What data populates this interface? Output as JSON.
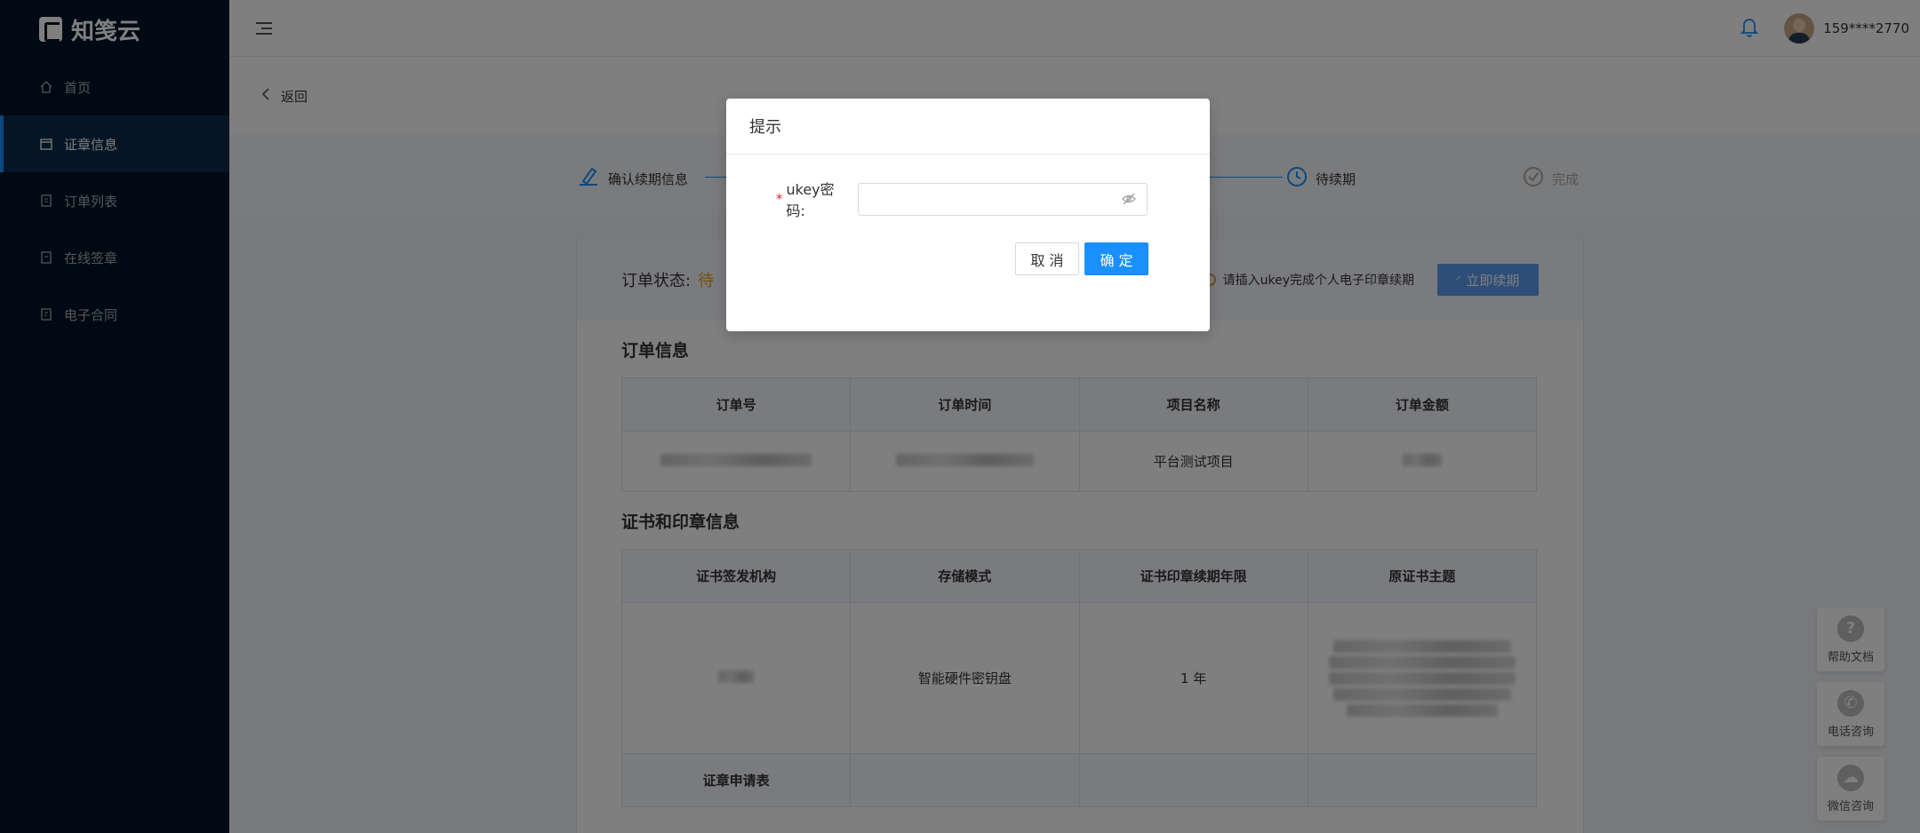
{
  "app": {
    "logo_text": "知笺云"
  },
  "sidebar": {
    "items": [
      {
        "label": "首页",
        "icon": "home-icon",
        "active": false
      },
      {
        "label": "证章信息",
        "icon": "stamp-icon",
        "active": true
      },
      {
        "label": "订单列表",
        "icon": "order-list-icon",
        "active": false
      },
      {
        "label": "在线签章",
        "icon": "sign-icon",
        "active": false
      },
      {
        "label": "电子合同",
        "icon": "contract-icon",
        "active": false
      }
    ]
  },
  "header": {
    "username": "159****2770"
  },
  "page": {
    "back_label": "返回"
  },
  "steps": [
    {
      "label": "确认续期信息"
    },
    {
      "label": "待续期"
    },
    {
      "label": "完成"
    }
  ],
  "order": {
    "status_label": "订单状态:",
    "status_value": "待",
    "tip": "请插入ukey完成个人电子印章续期",
    "renew_button": "立即续期"
  },
  "order_info": {
    "title": "订单信息",
    "headers": [
      "订单号",
      "订单时间",
      "项目名称",
      "订单金额"
    ],
    "row": [
      "",
      "",
      "平台测试项目",
      ""
    ]
  },
  "cert_info": {
    "title": "证书和印章信息",
    "headers": [
      "证书签发机构",
      "存储模式",
      "证书印章续期年限",
      "原证书主题"
    ],
    "row": [
      "",
      "智能硬件密钥盘",
      "1 年",
      ""
    ],
    "apply_label": "证章申请表"
  },
  "modal": {
    "title": "提示",
    "field_label": "ukey密码:",
    "required_mark": "*",
    "password_value": "",
    "cancel": "取 消",
    "confirm": "确 定"
  },
  "float_buttons": [
    {
      "label": "帮助文档",
      "icon": "help-icon"
    },
    {
      "label": "电话咨询",
      "icon": "phone-icon"
    },
    {
      "label": "微信咨询",
      "icon": "wechat-icon"
    }
  ],
  "colors": {
    "primary": "#1890ff",
    "sidebar_bg": "#001529",
    "warning": "#f19a2c"
  }
}
